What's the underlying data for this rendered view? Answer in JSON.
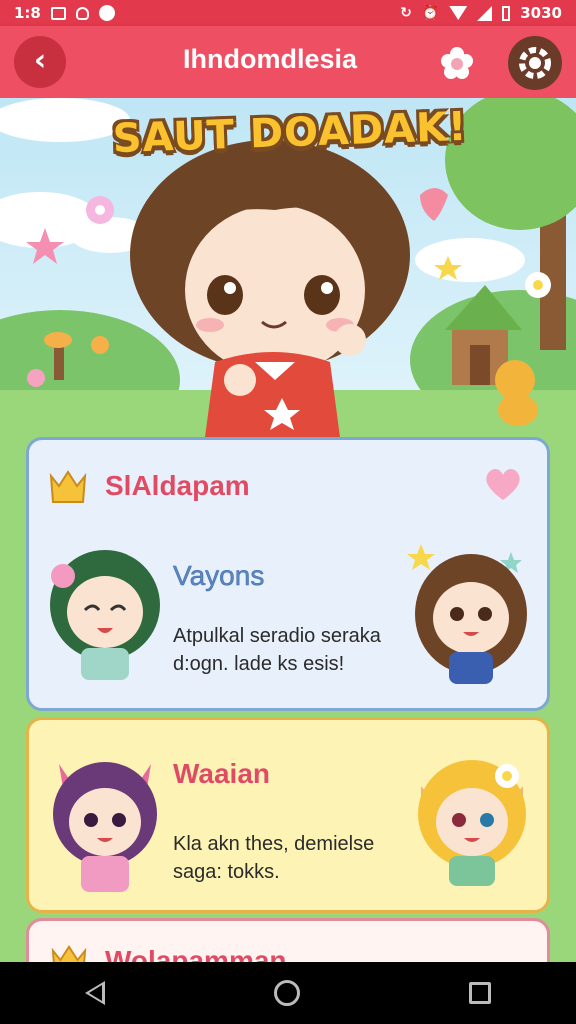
{
  "status_bar": {
    "time": "1:8",
    "battery": "3030"
  },
  "app_bar": {
    "title": "Ihndomdlesia",
    "back_icon": "chevron-left-icon",
    "flower_icon": "flower-icon",
    "settings_icon": "settings-icon"
  },
  "hero": {
    "banner": "SAUT DOADAK!"
  },
  "cards": [
    {
      "title": "SlAldapam",
      "subtitle": "Vayons",
      "description_line1": "Atpulkal seradio seraka",
      "description_line2": "d:ogn. lade ks esis!"
    },
    {
      "title": "Waaian",
      "description_line1": "Kla akn thes, demielse",
      "description_line2": "saga: tokks."
    },
    {
      "title": "Wolapamman"
    }
  ],
  "colors": {
    "app_bar": "#ee4f62",
    "status_bar": "#e23a4c",
    "card1_bg": "#e8f0fb",
    "card2_bg": "#fdf3b4",
    "card3_bg": "#fff4f1",
    "title_pink": "#e04b64",
    "subtitle_blue": "#5a86c2"
  },
  "nav_bar": {
    "back_icon": "nav-back-icon",
    "home_icon": "nav-home-icon",
    "recents_icon": "nav-recents-icon"
  }
}
